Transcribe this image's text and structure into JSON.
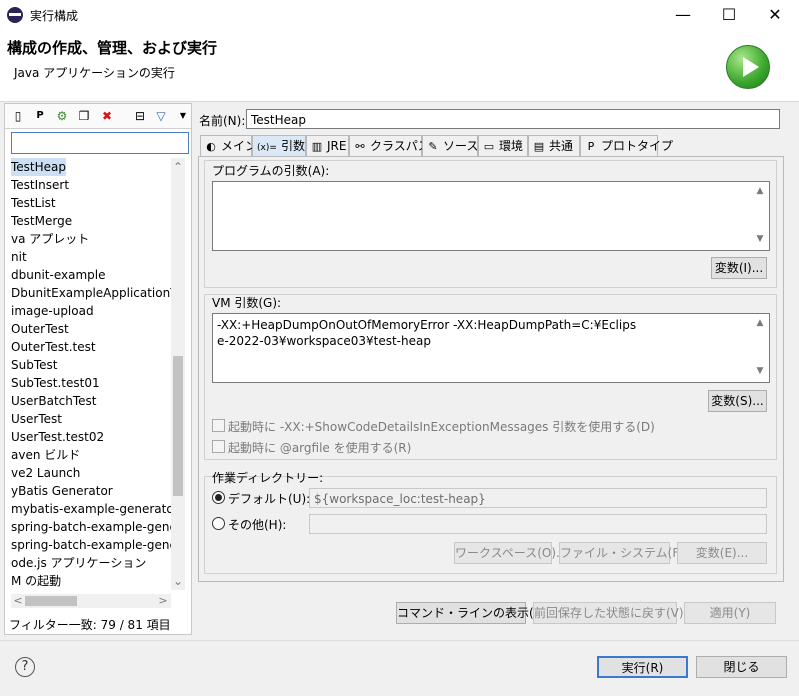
{
  "window": {
    "title": "実行構成",
    "minimize_glyph": "—",
    "maximize_glyph": "☐",
    "close_glyph": "✕"
  },
  "header": {
    "title": "構成の作成、管理、および実行",
    "subtitle": "Java アプリケーションの実行"
  },
  "left": {
    "filter_value": "",
    "items": [
      {
        "label": "TestHeap",
        "selected": true
      },
      {
        "label": "TestInsert"
      },
      {
        "label": "TestList"
      },
      {
        "label": "TestMerge"
      },
      {
        "label": "va アプレット"
      },
      {
        "label": "nit"
      },
      {
        "label": "dbunit-example"
      },
      {
        "label": "DbunitExampleApplicationTes"
      },
      {
        "label": "image-upload"
      },
      {
        "label": "OuterTest"
      },
      {
        "label": "OuterTest.test"
      },
      {
        "label": "SubTest"
      },
      {
        "label": "SubTest.test01"
      },
      {
        "label": "UserBatchTest"
      },
      {
        "label": "UserTest"
      },
      {
        "label": "UserTest.test02"
      },
      {
        "label": "aven ビルド"
      },
      {
        "label": "ve2 Launch"
      },
      {
        "label": "yBatis Generator"
      },
      {
        "label": "mybatis-example-generatorC"
      },
      {
        "label": "spring-batch-example-genera"
      },
      {
        "label": "spring-batch-example-genera"
      },
      {
        "label": "ode.js アプリケーション"
      },
      {
        "label": "M の起動"
      }
    ],
    "filter_status": "フィルター一致: 79 / 81 項目",
    "scroll_up": "⌃",
    "scroll_down": "⌄",
    "scroll_left": "<",
    "scroll_right": ">"
  },
  "main": {
    "name_label": "名前(N):",
    "name_value": "TestHeap",
    "tabs": [
      {
        "label": "メイン",
        "icon": "main-tab-icon",
        "glyph": "◐"
      },
      {
        "label": "引数",
        "icon": "arguments-tab-icon",
        "glyph": "(x)="
      },
      {
        "label": "JRE",
        "icon": "jre-tab-icon",
        "glyph": "▥"
      },
      {
        "label": "クラスパス",
        "icon": "classpath-tab-icon",
        "glyph": "⚯"
      },
      {
        "label": "ソース",
        "icon": "source-tab-icon",
        "glyph": "✎"
      },
      {
        "label": "環境",
        "icon": "environment-tab-icon",
        "glyph": "▭"
      },
      {
        "label": "共通",
        "icon": "common-tab-icon",
        "glyph": "▤"
      },
      {
        "label": "プロトタイプ",
        "icon": "prototype-tab-icon",
        "glyph": "P"
      }
    ],
    "program_args_label": "プログラムの引数(A):",
    "program_args_value": "",
    "program_vars_button": "変数(I)...",
    "vm_args_label": "VM 引数(G):",
    "vm_args_value": "-XX:+HeapDumpOnOutOfMemoryError -XX:HeapDumpPath=C:¥Eclipse-2022-03¥workspace03¥test-heap",
    "vm_vars_button": "変数(S)...",
    "checkbox1_label": "起動時に -XX:+ShowCodeDetailsInExceptionMessages 引数を使用する(D)",
    "checkbox2_label": "起動時に @argfile を使用する(R)",
    "workdir_label": "作業ディレクトリー:",
    "default_label": "デフォルト(U):",
    "default_value": "${workspace_loc:test-heap}",
    "other_label": "その他(H):",
    "other_value": "",
    "workspace_button": "ワークスペース(O)...",
    "filesystem_button": "ファイル・システム(F)...",
    "variables_button": "変数(E)...",
    "show_cmdline_button": "コマンド・ラインの表示(W)",
    "revert_button": "前回保存した状態に戻す(V)",
    "apply_button": "適用(Y)"
  },
  "footer": {
    "help_glyph": "?",
    "run_button": "実行(R)",
    "close_button": "閉じる"
  }
}
